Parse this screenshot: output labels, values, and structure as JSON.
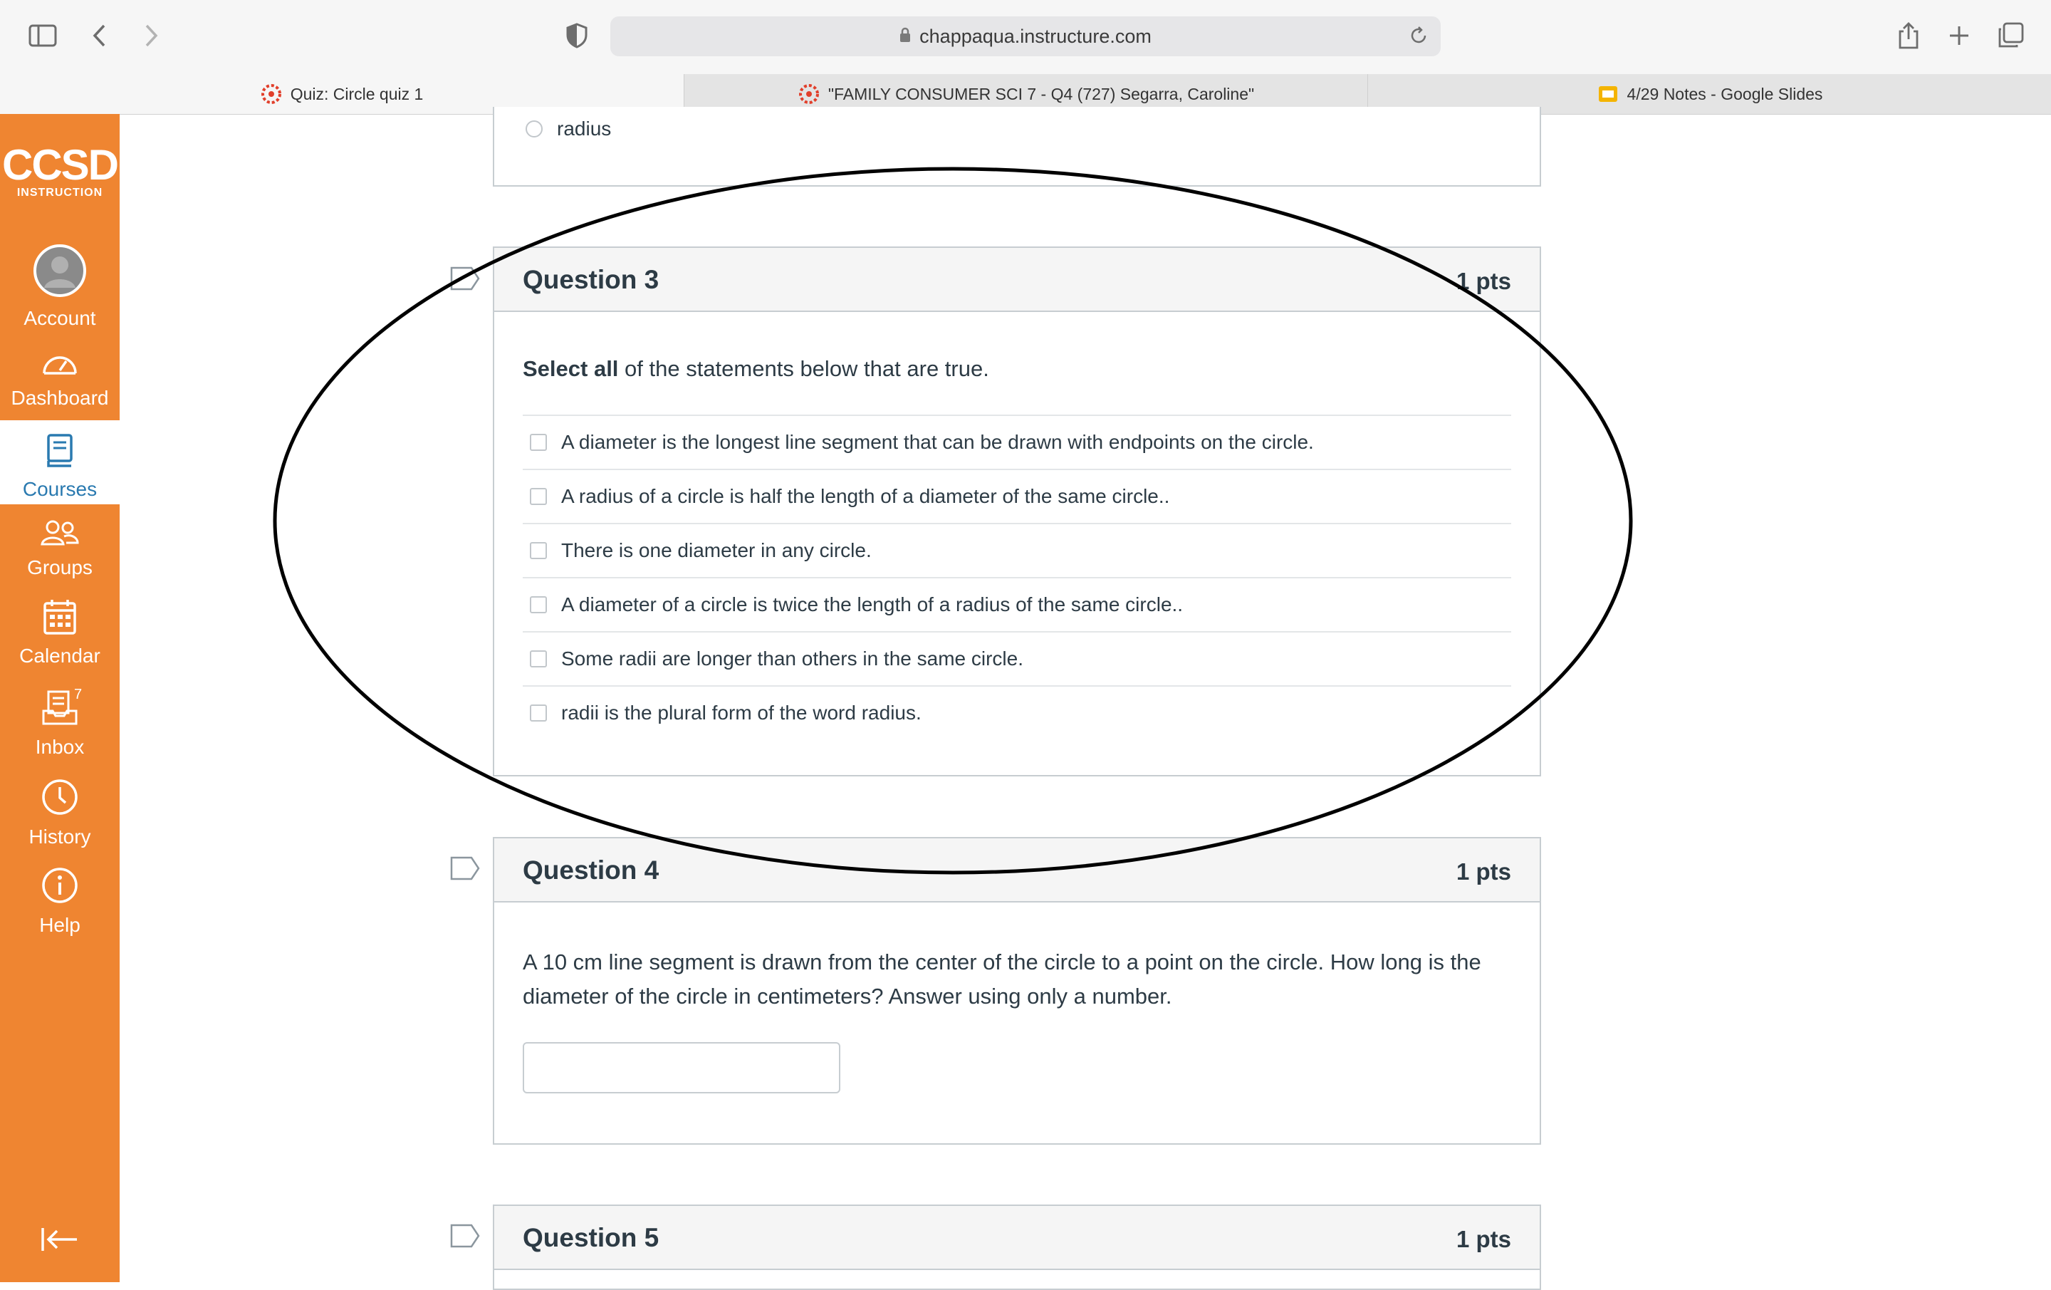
{
  "browser": {
    "url": "chappaqua.instructure.com",
    "tabs": [
      {
        "label": "Quiz: Circle quiz 1"
      },
      {
        "label": "\"FAMILY CONSUMER SCI 7 - Q4 (727) Segarra, Caroline\""
      },
      {
        "label": "4/29 Notes - Google Slides"
      }
    ]
  },
  "sidebar": {
    "brand": "CCSD",
    "brand_sub": "INSTRUCTION",
    "items": [
      {
        "label": "Account",
        "icon": "avatar-icon"
      },
      {
        "label": "Dashboard",
        "icon": "dashboard-icon"
      },
      {
        "label": "Courses",
        "icon": "book-icon"
      },
      {
        "label": "Groups",
        "icon": "groups-icon"
      },
      {
        "label": "Calendar",
        "icon": "calendar-icon"
      },
      {
        "label": "Inbox",
        "icon": "inbox-icon",
        "badge": "7"
      },
      {
        "label": "History",
        "icon": "clock-icon"
      },
      {
        "label": "Help",
        "icon": "info-icon"
      }
    ],
    "colors": {
      "background": "#ef8531",
      "active": "#2a7ab0"
    }
  },
  "prev_question": {
    "option": "radius"
  },
  "question3": {
    "title": "Question 3",
    "points": "1 pts",
    "prompt_bold": "Select all",
    "prompt_rest": " of the statements below that are true.",
    "answers": [
      "A diameter is the longest line segment that can be drawn with endpoints on the circle.",
      "A radius of a circle is half the length of a diameter of the same circle..",
      "There is one diameter in any circle.",
      "A diameter of a circle is twice the length of a radius of the same circle..",
      "Some radii are longer than others in the same circle.",
      "radii is the plural form of the word radius."
    ]
  },
  "question4": {
    "title": "Question 4",
    "points": "1 pts",
    "prompt": "A 10 cm line segment is drawn from the center of the circle to a point on the circle.  How long is the diameter of the circle in centimeters?  Answer using only a number.",
    "answer_value": ""
  },
  "question5": {
    "title": "Question 5",
    "points": "1 pts"
  }
}
